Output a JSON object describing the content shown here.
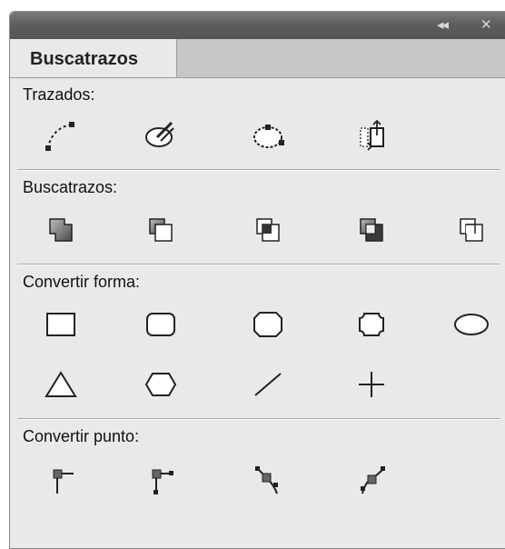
{
  "window": {
    "collapse_glyph": "◂◂",
    "close_glyph": "✕"
  },
  "tabs": [
    {
      "label": "Buscatrazos",
      "active": true
    }
  ],
  "sections": [
    {
      "label": "Trazados:",
      "buttons": [
        "join-icon",
        "outline-stroke-icon",
        "offset-path-icon",
        "reverse-path-icon"
      ]
    },
    {
      "label": "Buscatrazos:",
      "buttons": [
        "unite-icon",
        "minus-front-icon",
        "intersect-icon",
        "exclude-icon",
        "divide-icon"
      ]
    },
    {
      "label": "Convertir forma:",
      "buttons": [
        "rectangle-icon",
        "rounded-rectangle-icon",
        "beveled-rectangle-icon",
        "inverse-rounded-rectangle-icon",
        "ellipse-icon",
        "triangle-icon",
        "polygon-icon",
        "line-icon",
        "orthogonal-line-icon"
      ]
    },
    {
      "label": "Convertir punto:",
      "buttons": [
        "plain-point-icon",
        "corner-point-icon",
        "smooth-point-icon",
        "symmetrical-point-icon"
      ]
    }
  ],
  "colors": {
    "panel_bg": "#e9e9e9",
    "titlebar": "#5e5e5e",
    "tabstrip": "#c6c6c6",
    "icon_stroke": "#222222"
  }
}
